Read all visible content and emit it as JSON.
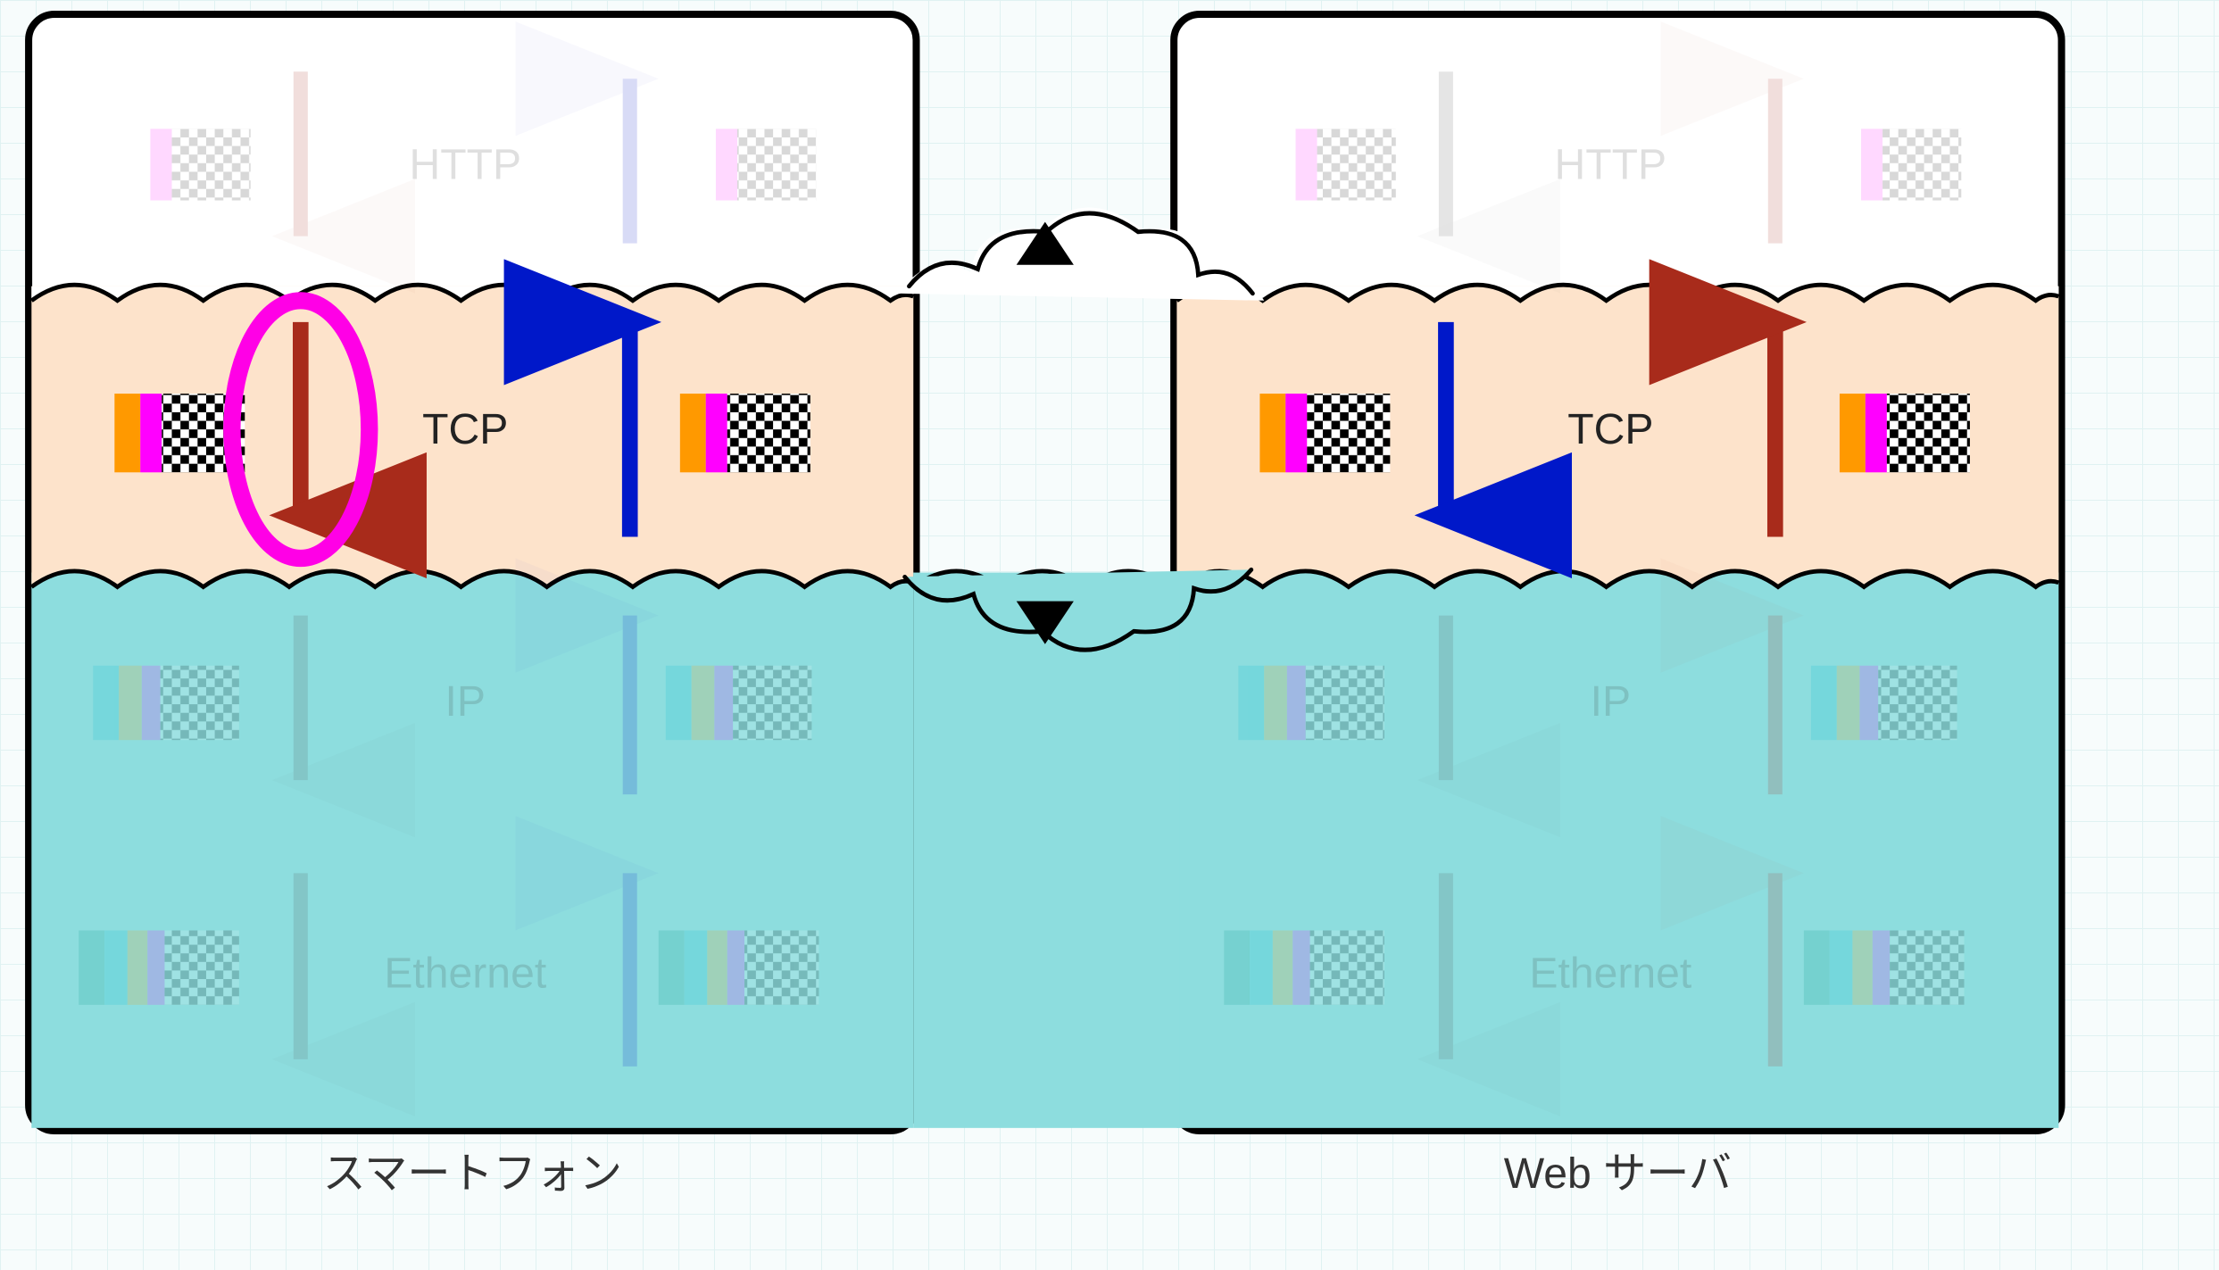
{
  "diagram": {
    "left_label": "スマートフォン",
    "right_label": "Web サーバ",
    "layers": {
      "http": "HTTP",
      "tcp": "TCP",
      "ip": "IP",
      "eth": "Ethernet"
    },
    "highlight": {
      "ellipse_on": "left_tcp_down_arrow"
    },
    "colors": {
      "tcp_bg": "#fde3cb",
      "tcp_header": "#ff9900",
      "http_header": "#ff00ff",
      "ip_header": "#00bcd4",
      "eth_bg": "#8dddde",
      "border": "#000000",
      "down_arrow": "#a82b1b",
      "up_arrow_left": "#0018c9",
      "down_arrow_right": "#0018c9",
      "up_arrow_right": "#a82b1b",
      "highlight_ring": "#ff00e6",
      "faded_overlay": "#ffffff"
    }
  }
}
